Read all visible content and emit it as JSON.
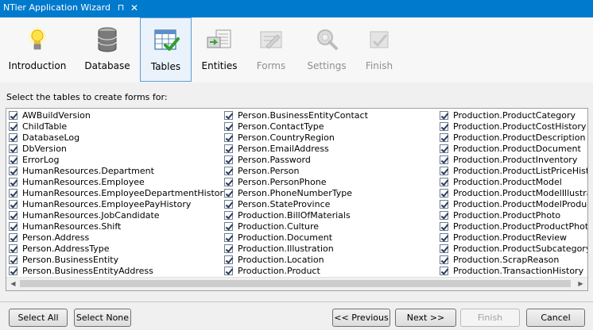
{
  "window": {
    "title": "NTier Application Wizard",
    "pin_glyph": "⊓",
    "close_glyph": "✕"
  },
  "steps": [
    {
      "label": "Introduction",
      "icon": "lightbulb-icon",
      "enabled": true,
      "active": false
    },
    {
      "label": "Database",
      "icon": "database-icon",
      "enabled": true,
      "active": false
    },
    {
      "label": "Tables",
      "icon": "table-check-icon",
      "enabled": true,
      "active": true
    },
    {
      "label": "Entities",
      "icon": "entities-icon",
      "enabled": true,
      "active": false
    },
    {
      "label": "Forms",
      "icon": "forms-icon",
      "enabled": false,
      "active": false
    },
    {
      "label": "Settings",
      "icon": "settings-icon",
      "enabled": false,
      "active": false
    },
    {
      "label": "Finish",
      "icon": "finish-icon",
      "enabled": false,
      "active": false
    }
  ],
  "instruction": "Select the tables to create forms for:",
  "tables": {
    "columns": [
      [
        "AWBuildVersion",
        "ChildTable",
        "DatabaseLog",
        "DbVersion",
        "ErrorLog",
        "HumanResources.Department",
        "HumanResources.Employee",
        "HumanResources.EmployeeDepartmentHistory",
        "HumanResources.EmployeePayHistory",
        "HumanResources.JobCandidate",
        "HumanResources.Shift",
        "Person.Address",
        "Person.AddressType",
        "Person.BusinessEntity",
        "Person.BusinessEntityAddress"
      ],
      [
        "Person.BusinessEntityContact",
        "Person.ContactType",
        "Person.CountryRegion",
        "Person.EmailAddress",
        "Person.Password",
        "Person.Person",
        "Person.PersonPhone",
        "Person.PhoneNumberType",
        "Person.StateProvince",
        "Production.BillOfMaterials",
        "Production.Culture",
        "Production.Document",
        "Production.Illustration",
        "Production.Location",
        "Production.Product"
      ],
      [
        "Production.ProductCategory",
        "Production.ProductCostHistory",
        "Production.ProductDescription",
        "Production.ProductDocument",
        "Production.ProductInventory",
        "Production.ProductListPriceHistory",
        "Production.ProductModel",
        "Production.ProductModelIllustration",
        "Production.ProductModelProductDes",
        "Production.ProductPhoto",
        "Production.ProductProductPhoto",
        "Production.ProductReview",
        "Production.ProductSubcategory",
        "Production.ScrapReason",
        "Production.TransactionHistory"
      ]
    ],
    "all_checked": true
  },
  "scrollbar": {
    "left_arrow": "◀",
    "right_arrow": "▶"
  },
  "buttons": {
    "select_all": "Select All",
    "select_none": "Select None",
    "previous": "<< Previous",
    "next": "Next >>",
    "finish": "Finish",
    "cancel": "Cancel"
  }
}
